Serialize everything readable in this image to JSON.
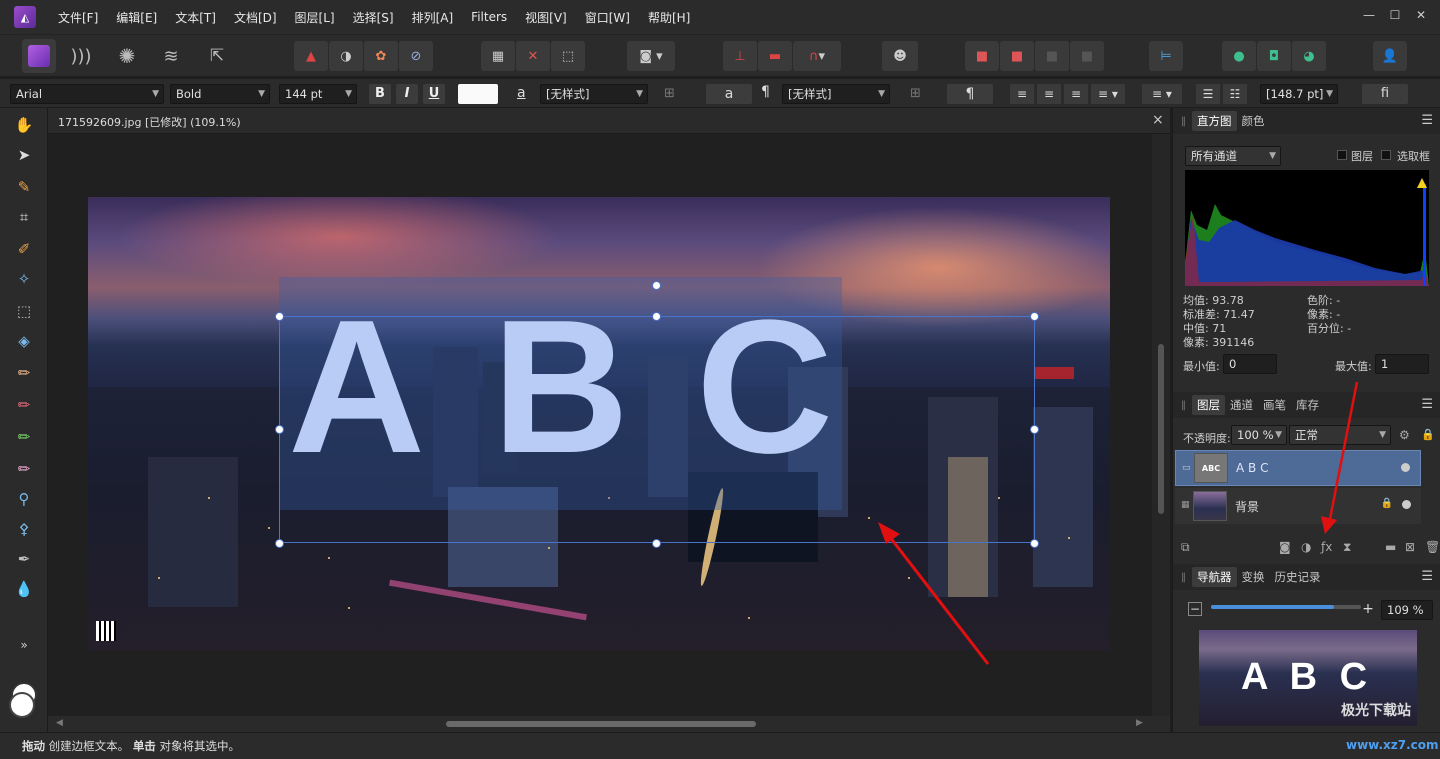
{
  "menu": [
    "文件[F]",
    "编辑[E]",
    "文本[T]",
    "文档[D]",
    "图层[L]",
    "选择[S]",
    "排列[A]",
    "Filters",
    "视图[V]",
    "窗口[W]",
    "帮助[H]"
  ],
  "colors": {
    "accent": "#4a74c9",
    "logo": "#9b4dca",
    "arrow": "#e01010"
  },
  "text_toolbar": {
    "font_family": "Arial",
    "font_style": "Bold",
    "font_size": "144 pt",
    "bold": "B",
    "italic": "I",
    "underline": "U",
    "char_style_icon": "a",
    "char_style": "[无样式]",
    "char_btn": "a",
    "para_icon": "¶",
    "para_style": "[无样式]",
    "para_btn": "¶",
    "leading": "[148.7 pt]",
    "ligature": "fi"
  },
  "document": {
    "tab_title": "171592609.jpg [已修改] (109.1%)",
    "close": "×",
    "artistic_text": [
      "A",
      "B",
      "C"
    ]
  },
  "status": {
    "drag_label": "拖动",
    "drag_text": " 创建边框文本。",
    "click_label": "单击",
    "click_text": " 对象将其选中。"
  },
  "histogram": {
    "tab_active": "直方图",
    "tab2": "颜色",
    "channel": "所有通道",
    "layer_cb": "图层",
    "marquee_cb": "选取框",
    "mean": "均值: 93.78",
    "stddev": "标准差: 71.47",
    "median": "中值: 71",
    "pixels": "像素: 391146",
    "level": "色阶: -",
    "count": "像素: -",
    "percentile": "百分位: -",
    "min_label": "最小值:",
    "min_value": "0",
    "max_label": "最大值:",
    "max_value": "1"
  },
  "layers_panel": {
    "tabs": [
      "图层",
      "通道",
      "画笔",
      "库存"
    ],
    "opacity_label": "不透明度:",
    "opacity": "100 %",
    "blend": "正常",
    "layers": [
      {
        "name": "A B C"
      },
      {
        "name": "背景"
      }
    ]
  },
  "navigator": {
    "tabs": [
      "导航器",
      "变换",
      "历史记录"
    ],
    "zoom": "109 %",
    "zoom_fraction": 0.82,
    "preview_text": "A B C"
  },
  "watermark": {
    "brand": "极光下载站",
    "url": "www.xz7.com"
  }
}
